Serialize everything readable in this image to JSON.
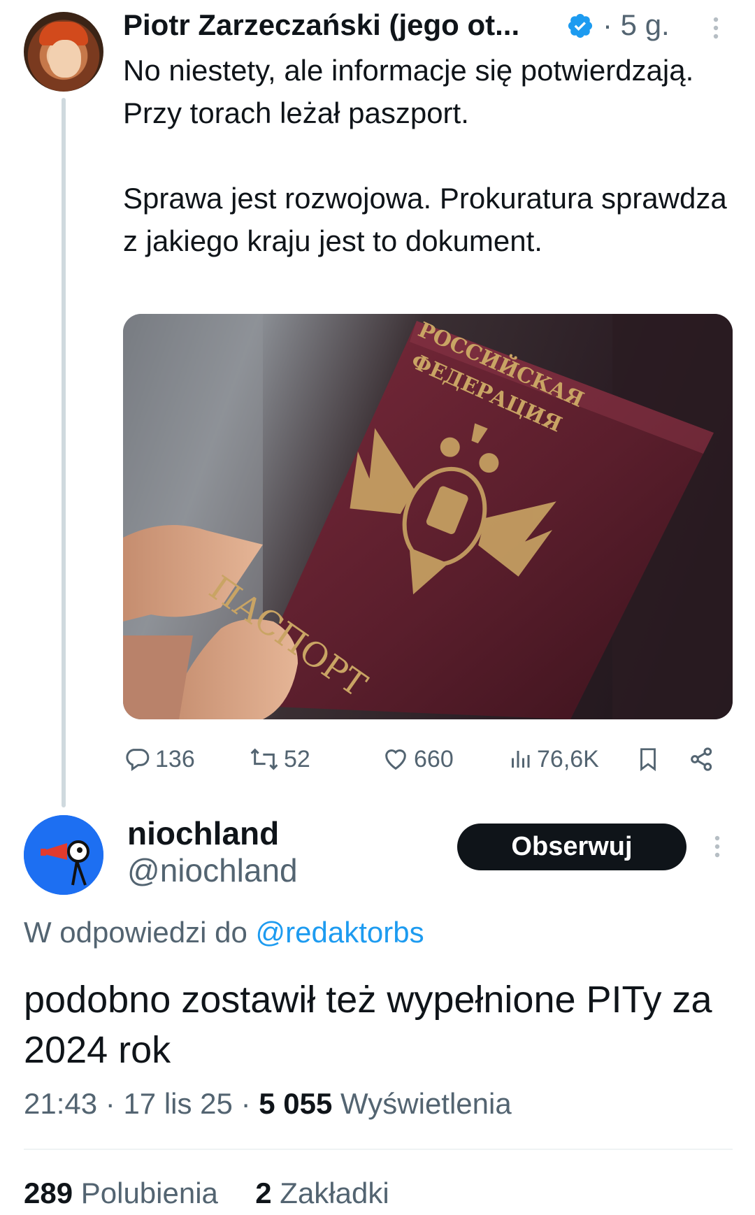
{
  "parent_tweet": {
    "author_name": "Piotr Zarzeczański (jego ot...",
    "separator": "·",
    "time": "5 g.",
    "text": "No niestety, ale informacje się potwierdzają. Przy torach leżał paszport.\n\nSprawa jest rozwojowa. Prokuratura sprawdza z jakiego kraju jest to dokument.",
    "media": {
      "cover_line1": "РОССИЙСКАЯ",
      "cover_line2": "ФЕДЕРАЦИЯ",
      "cover_word": "ПАСПОРТ"
    },
    "actions": {
      "replies": "136",
      "reposts": "52",
      "likes": "660",
      "views": "76,6K"
    }
  },
  "reply_tweet": {
    "author_name": "niochland",
    "handle": "@niochland",
    "follow_label": "Obserwuj",
    "reply_prefix": "W odpowiedzi do",
    "reply_mention": "@redaktorbs",
    "text": "podobno zostawił też wypełnione PITy za 2024 rok",
    "meta": {
      "time": "21:43",
      "date": "17 lis 25",
      "separator": "·",
      "views_count": "5 055",
      "views_label": "Wyświetlenia"
    },
    "stats": {
      "likes_count": "289",
      "likes_label": "Polubienia",
      "bookmarks_count": "2",
      "bookmarks_label": "Zakładki"
    }
  },
  "colors": {
    "text": "#0f1419",
    "secondary": "#536471",
    "link": "#1d9bf0",
    "verified": "#1d9bf0",
    "button_bg": "#0f1419",
    "passport": "#5a1e2c"
  },
  "icons": [
    "verified-badge-icon",
    "more-options-icon",
    "reply-icon",
    "repost-icon",
    "like-icon",
    "views-icon",
    "bookmark-icon",
    "share-icon"
  ]
}
